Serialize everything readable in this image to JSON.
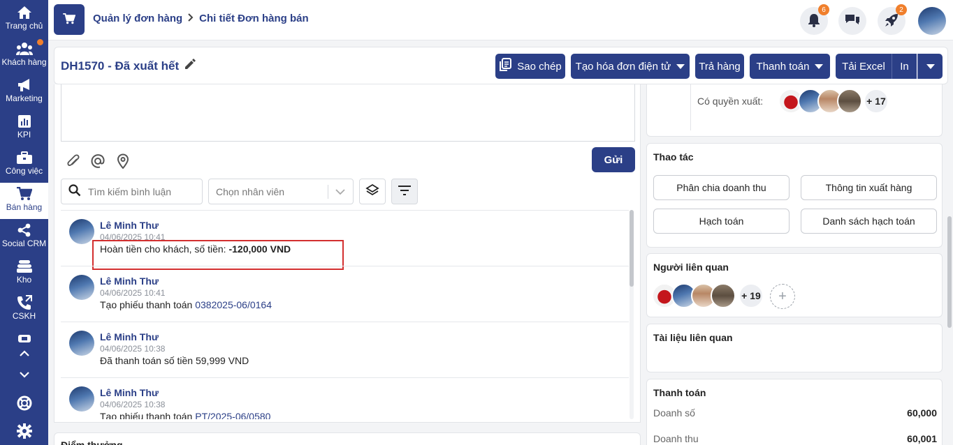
{
  "sidebar": {
    "items": [
      {
        "label": "Trang chủ",
        "icon": "home-icon"
      },
      {
        "label": "Khách hàng",
        "icon": "users-icon"
      },
      {
        "label": "Marketing",
        "icon": "megaphone-icon"
      },
      {
        "label": "KPI",
        "icon": "chart-icon"
      },
      {
        "label": "Công việc",
        "icon": "briefcase-icon"
      },
      {
        "label": "Bán hàng",
        "icon": "cart-icon"
      },
      {
        "label": "Social CRM",
        "icon": "share-icon"
      },
      {
        "label": "Kho",
        "icon": "warehouse-icon"
      },
      {
        "label": "CSKH",
        "icon": "phone-icon"
      }
    ]
  },
  "header": {
    "breadcrumb": [
      "Quản lý đơn hàng",
      "Chi tiết Đơn hàng bán"
    ],
    "notif_count": "6",
    "rocket_count": "2"
  },
  "order": {
    "title": "DH1570 - Đã xuất hết",
    "buttons": {
      "copy": "Sao chép",
      "einvoice": "Tạo hóa đơn điện tử",
      "return": "Trả hàng",
      "payment": "Thanh toán",
      "excel": "Tải Excel",
      "print": "In"
    }
  },
  "composer": {
    "send_label": "Gửi",
    "search_placeholder": "Tìm kiếm bình luận",
    "staff_placeholder": "Chọn nhân viên"
  },
  "comments": [
    {
      "name": "Lê Minh Thư",
      "time": "04/06/2025 10:41",
      "text": "Hoàn tiền cho khách, số tiền: ",
      "bold": "-120,000 VND",
      "link": ""
    },
    {
      "name": "Lê Minh Thư",
      "time": "04/06/2025 10:41",
      "text": "Tạo phiếu thanh toán ",
      "bold": "",
      "link": "0382025-06/0164"
    },
    {
      "name": "Lê Minh Thư",
      "time": "04/06/2025 10:38",
      "text": "Đã thanh toán số tiền 59,999 VND",
      "bold": "",
      "link": ""
    },
    {
      "name": "Lê Minh Thư",
      "time": "04/06/2025 10:38",
      "text": "Tạo phiếu thanh toán ",
      "bold": "",
      "link": "PT/2025-06/0580"
    }
  ],
  "bonus_title": "Điểm thưởng",
  "right": {
    "export_label": "Có quyền xuất:",
    "export_more": "+ 17",
    "actions_title": "Thao tác",
    "actions": [
      "Phân chia doanh thu",
      "Thông tin xuất hàng",
      "Hạch toán",
      "Danh sách hạch toán"
    ],
    "related_title": "Người liên quan",
    "related_more": "+ 19",
    "docs_title": "Tài liệu liên quan",
    "payment_title": "Thanh toán",
    "payment_rows": [
      {
        "label": "Doanh số",
        "value": "60,000"
      },
      {
        "label": "Doanh thu",
        "value": "60,001"
      }
    ]
  },
  "colors": {
    "primary": "#2b3f87",
    "badge": "#f07f2c",
    "highlight": "#d32f2f"
  }
}
